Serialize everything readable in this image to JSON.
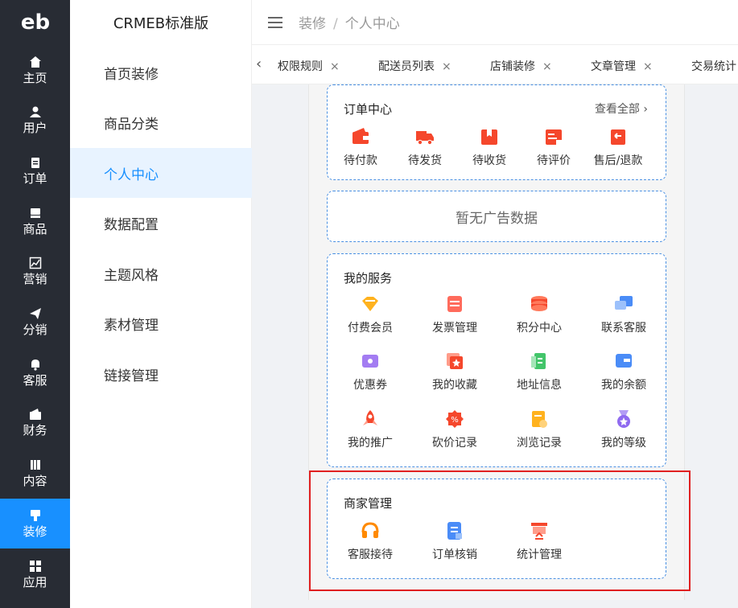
{
  "logo": {
    "text": "eb"
  },
  "rail": {
    "items": [
      {
        "label": "主页",
        "icon": "home-icon"
      },
      {
        "label": "用户",
        "icon": "user-icon"
      },
      {
        "label": "订单",
        "icon": "clipboard-icon"
      },
      {
        "label": "商品",
        "icon": "shop-icon"
      },
      {
        "label": "营销",
        "icon": "chart-icon"
      },
      {
        "label": "分销",
        "icon": "send-icon"
      },
      {
        "label": "客服",
        "icon": "bell-icon"
      },
      {
        "label": "财务",
        "icon": "wallet-icon"
      },
      {
        "label": "内容",
        "icon": "book-icon"
      },
      {
        "label": "装修",
        "icon": "brush-icon"
      },
      {
        "label": "应用",
        "icon": "apps-icon"
      }
    ],
    "active_index": 9
  },
  "submenu": {
    "title": "CRMEB标准版",
    "items": [
      "首页装修",
      "商品分类",
      "个人中心",
      "数据配置",
      "主题风格",
      "素材管理",
      "链接管理"
    ],
    "active_index": 2
  },
  "header": {
    "crumb1": "装修",
    "separator": "/",
    "crumb2": "个人中心"
  },
  "tabs": {
    "items": [
      "权限规则",
      "配送员列表",
      "店铺装修",
      "文章管理",
      "交易统计"
    ],
    "close": "×",
    "back": "‹"
  },
  "order_center": {
    "title": "订单中心",
    "more": "查看全部 ›",
    "items": [
      {
        "label": "待付款",
        "icon": "wallet-icon"
      },
      {
        "label": "待发货",
        "icon": "truck-icon"
      },
      {
        "label": "待收货",
        "icon": "package-icon"
      },
      {
        "label": "待评价",
        "icon": "review-icon"
      },
      {
        "label": "售后/退款",
        "icon": "refund-icon"
      }
    ]
  },
  "ad": {
    "text": "暂无广告数据"
  },
  "my_services": {
    "title": "我的服务",
    "items": [
      {
        "label": "付费会员",
        "icon": "vip-icon"
      },
      {
        "label": "发票管理",
        "icon": "invoice-icon"
      },
      {
        "label": "积分中心",
        "icon": "coins-icon"
      },
      {
        "label": "联系客服",
        "icon": "chat-icon"
      },
      {
        "label": "优惠券",
        "icon": "coupon-icon"
      },
      {
        "label": "我的收藏",
        "icon": "favorite-icon"
      },
      {
        "label": "地址信息",
        "icon": "address-icon"
      },
      {
        "label": "我的余额",
        "icon": "balance-icon"
      },
      {
        "label": "我的推广",
        "icon": "rocket-icon"
      },
      {
        "label": "砍价记录",
        "icon": "discount-icon"
      },
      {
        "label": "浏览记录",
        "icon": "history-icon"
      },
      {
        "label": "我的等级",
        "icon": "medal-icon"
      }
    ]
  },
  "merchant": {
    "title": "商家管理",
    "items": [
      {
        "label": "客服接待",
        "icon": "headset-icon"
      },
      {
        "label": "订单核销",
        "icon": "verify-icon"
      },
      {
        "label": "统计管理",
        "icon": "stats-icon"
      }
    ]
  },
  "colors": {
    "accent": "#1890ff",
    "rail_bg": "#282c34",
    "highlight": "#e02020",
    "orange": "#ff8a00",
    "red": "#f5472c",
    "blue": "#4a8cf7"
  }
}
